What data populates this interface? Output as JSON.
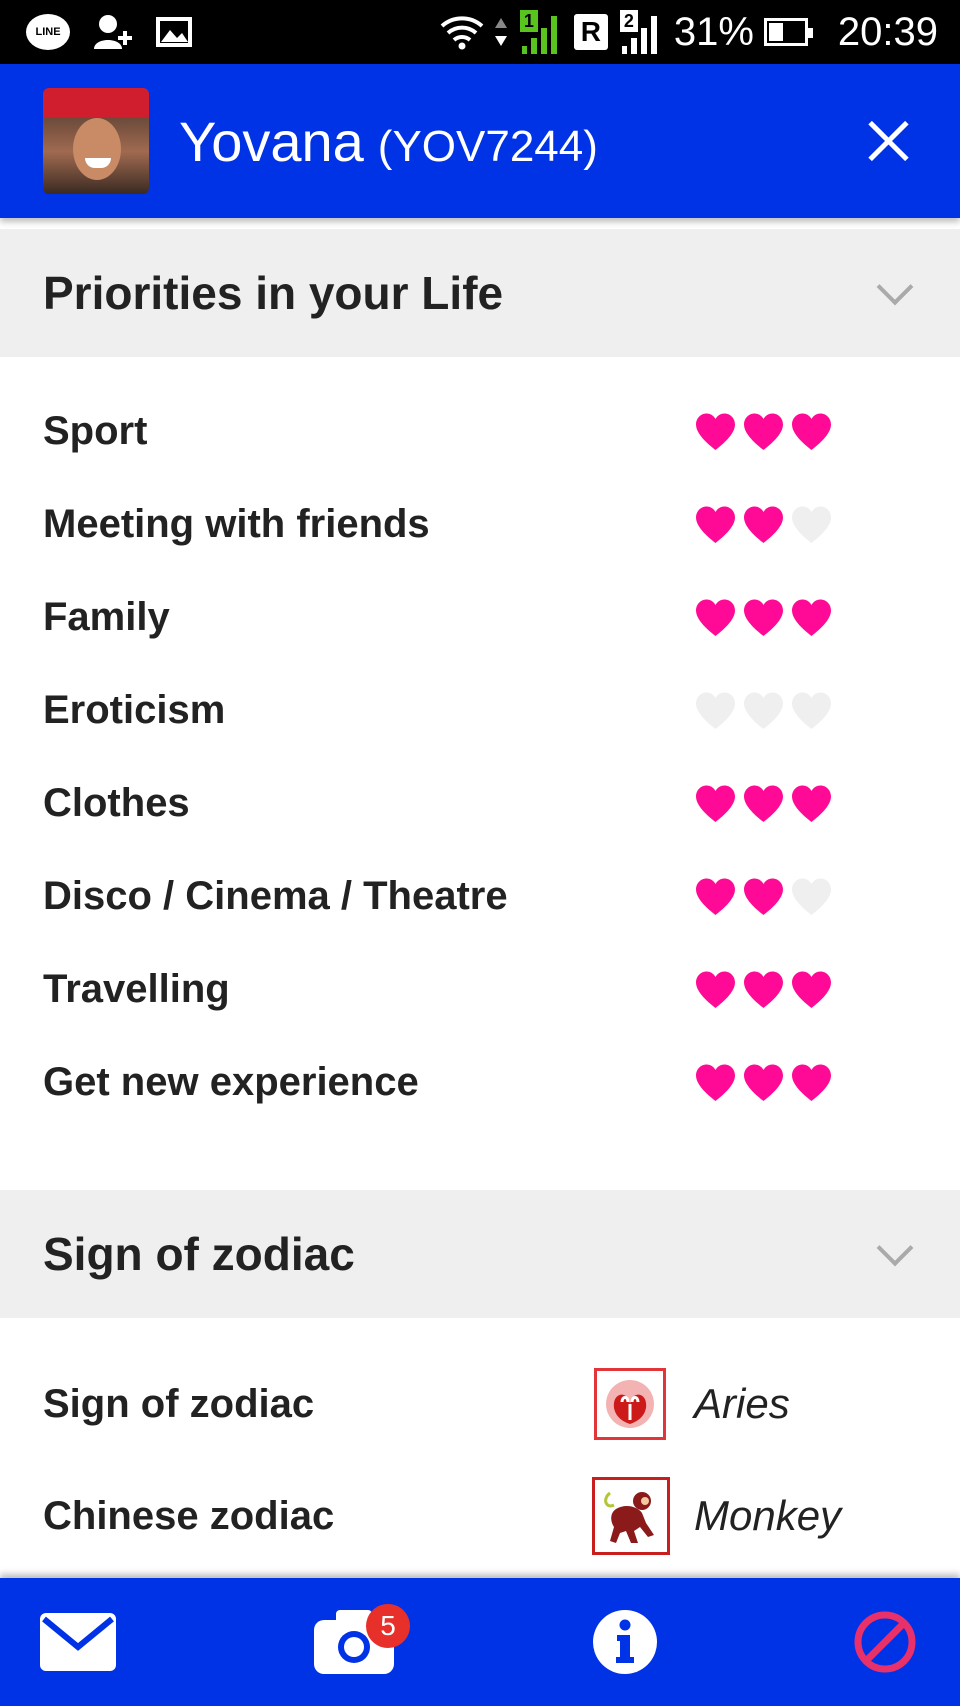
{
  "status_bar": {
    "line_label": "LINE",
    "sim1": "1",
    "roaming": "R",
    "sim2": "2",
    "battery": "31%",
    "time": "20:39",
    "icons": [
      "line-icon",
      "add-contact-icon",
      "image-icon",
      "wifi-icon",
      "signal-icon",
      "battery-icon"
    ]
  },
  "header": {
    "name": "Yovana",
    "id": "(YOV7244)",
    "accent": "#0033e6"
  },
  "priorities": {
    "title": "Priorities in your Life",
    "items": [
      {
        "label": "Sport",
        "hearts": 3
      },
      {
        "label": "Meeting with friends",
        "hearts": 2
      },
      {
        "label": "Family",
        "hearts": 3
      },
      {
        "label": "Eroticism",
        "hearts": 0
      },
      {
        "label": "Clothes",
        "hearts": 3
      },
      {
        "label": "Disco / Cinema / Theatre",
        "hearts": 2
      },
      {
        "label": "Travelling",
        "hearts": 3
      },
      {
        "label": "Get new experience",
        "hearts": 3
      }
    ],
    "max_hearts": 3,
    "heart_on": "#ff0a96",
    "heart_off": "#efefef"
  },
  "zodiac": {
    "title": "Sign of zodiac",
    "items": [
      {
        "label": "Sign of zodiac",
        "value": "Aries",
        "icon": "aries-icon"
      },
      {
        "label": "Chinese zodiac",
        "value": "Monkey",
        "icon": "monkey-icon"
      }
    ]
  },
  "bottom_bar": {
    "photos_badge": "5",
    "icons": [
      "mail-icon",
      "camera-icon",
      "info-icon",
      "block-icon"
    ],
    "block_color": "#e8306a"
  }
}
